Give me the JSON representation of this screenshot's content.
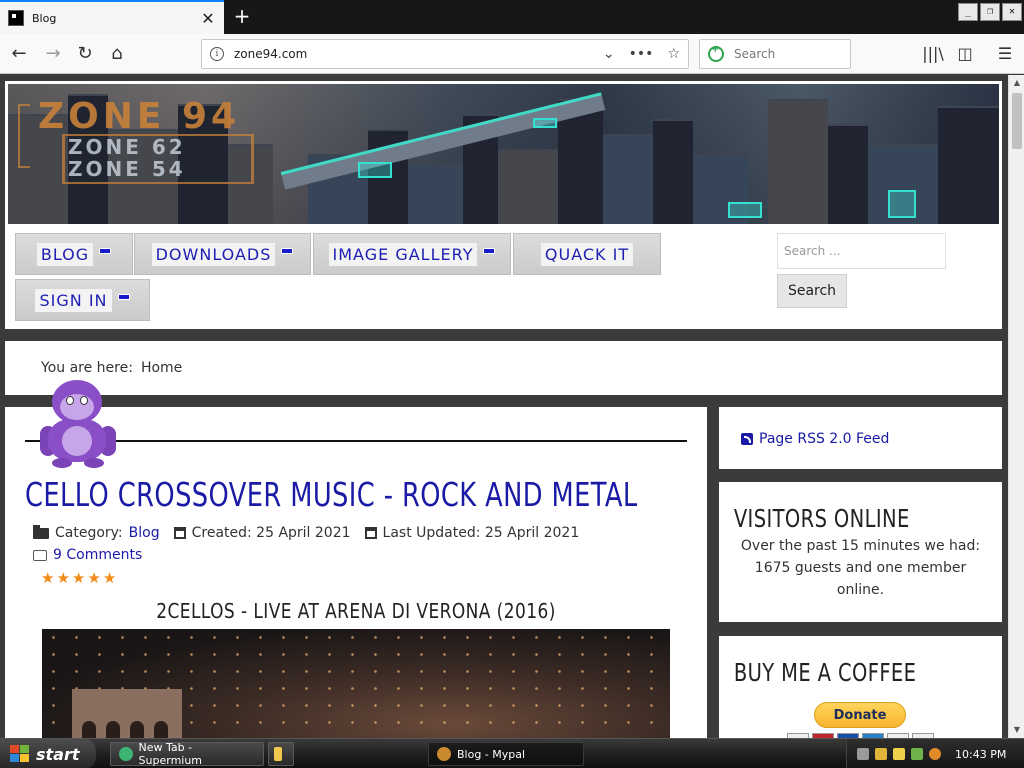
{
  "browser": {
    "tab_title": "Blog",
    "tab_close": "✕",
    "new_tab": "+",
    "url": "zone94.com",
    "search_placeholder": "Search",
    "window_buttons": [
      "_",
      "❐",
      "✕"
    ]
  },
  "site": {
    "logo_main": "ZONE 94",
    "logo_sub_1": "ZONE 62",
    "logo_sub_2": "ZONE 54",
    "menu": [
      {
        "label": "BLOG"
      },
      {
        "label": "DOWNLOADS"
      },
      {
        "label": "IMAGE GALLERY"
      },
      {
        "label": "QUACK IT"
      },
      {
        "label": "SIGN IN"
      }
    ],
    "search_placeholder": "Search ...",
    "search_button": "Search"
  },
  "breadcrumb": {
    "prefix": "You are here:",
    "current": "Home"
  },
  "article": {
    "title": "CELLO CROSSOVER MUSIC - ROCK AND METAL",
    "category_label": "Category:",
    "category": "Blog",
    "created": "Created: 25 April 2021",
    "updated": "Last Updated: 25 April 2021",
    "comments": "9 Comments",
    "rating": 5,
    "video_title": "2CELLOS - LIVE AT ARENA DI VERONA (2016)"
  },
  "sidebar": {
    "rss": "Page RSS 2.0 Feed",
    "visitors_heading": "VISITORS ONLINE",
    "visitors_text": "Over the past 15 minutes we had: 1675 guests and one member online.",
    "coffee_heading": "BUY ME A COFFEE",
    "donate": "Donate"
  },
  "taskbar": {
    "start": "start",
    "tasks": [
      {
        "label": "New Tab - Supermium"
      },
      {
        "label": ""
      },
      {
        "label": "Blog - Mypal"
      }
    ],
    "clock": "10:43 PM"
  }
}
